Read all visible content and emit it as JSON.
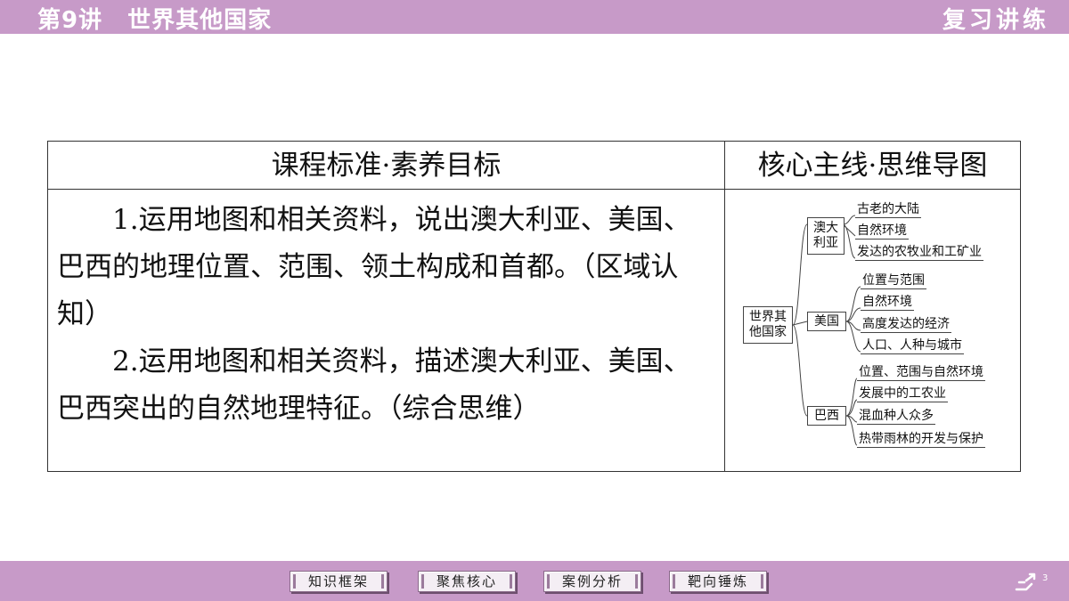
{
  "header": {
    "lesson_number": "第9讲",
    "lesson_title": "世界其他国家",
    "section": "复习讲练"
  },
  "table": {
    "col1_header": "课程标准·素养目标",
    "col2_header": "核心主线·思维导图",
    "objectives": [
      "1.运用地图和相关资料，说出澳大利亚、美国、巴西的地理位置、范围、领土构成和首都。（区域认知）",
      "2.运用地图和相关资料，描述澳大利亚、美国、巴西突出的自然地理特征。（综合思维）"
    ]
  },
  "mindmap": {
    "root": "世界其他国家",
    "branches": [
      {
        "label": "澳大利亚",
        "items": [
          "古老的大陆",
          "自然环境",
          "发达的农牧业和工矿业"
        ]
      },
      {
        "label": "美国",
        "items": [
          "位置与范围",
          "自然环境",
          "高度发达的经济",
          "人口、人种与城市"
        ]
      },
      {
        "label": "巴西",
        "items": [
          "位置、范围与自然环境",
          "发展中的工农业",
          "混血种人众多",
          "热带雨林的开发与保护"
        ]
      }
    ]
  },
  "footer": {
    "nav": [
      "知识框架",
      "聚焦核心",
      "案例分析",
      "靶向锤炼"
    ],
    "page_number": "3"
  }
}
